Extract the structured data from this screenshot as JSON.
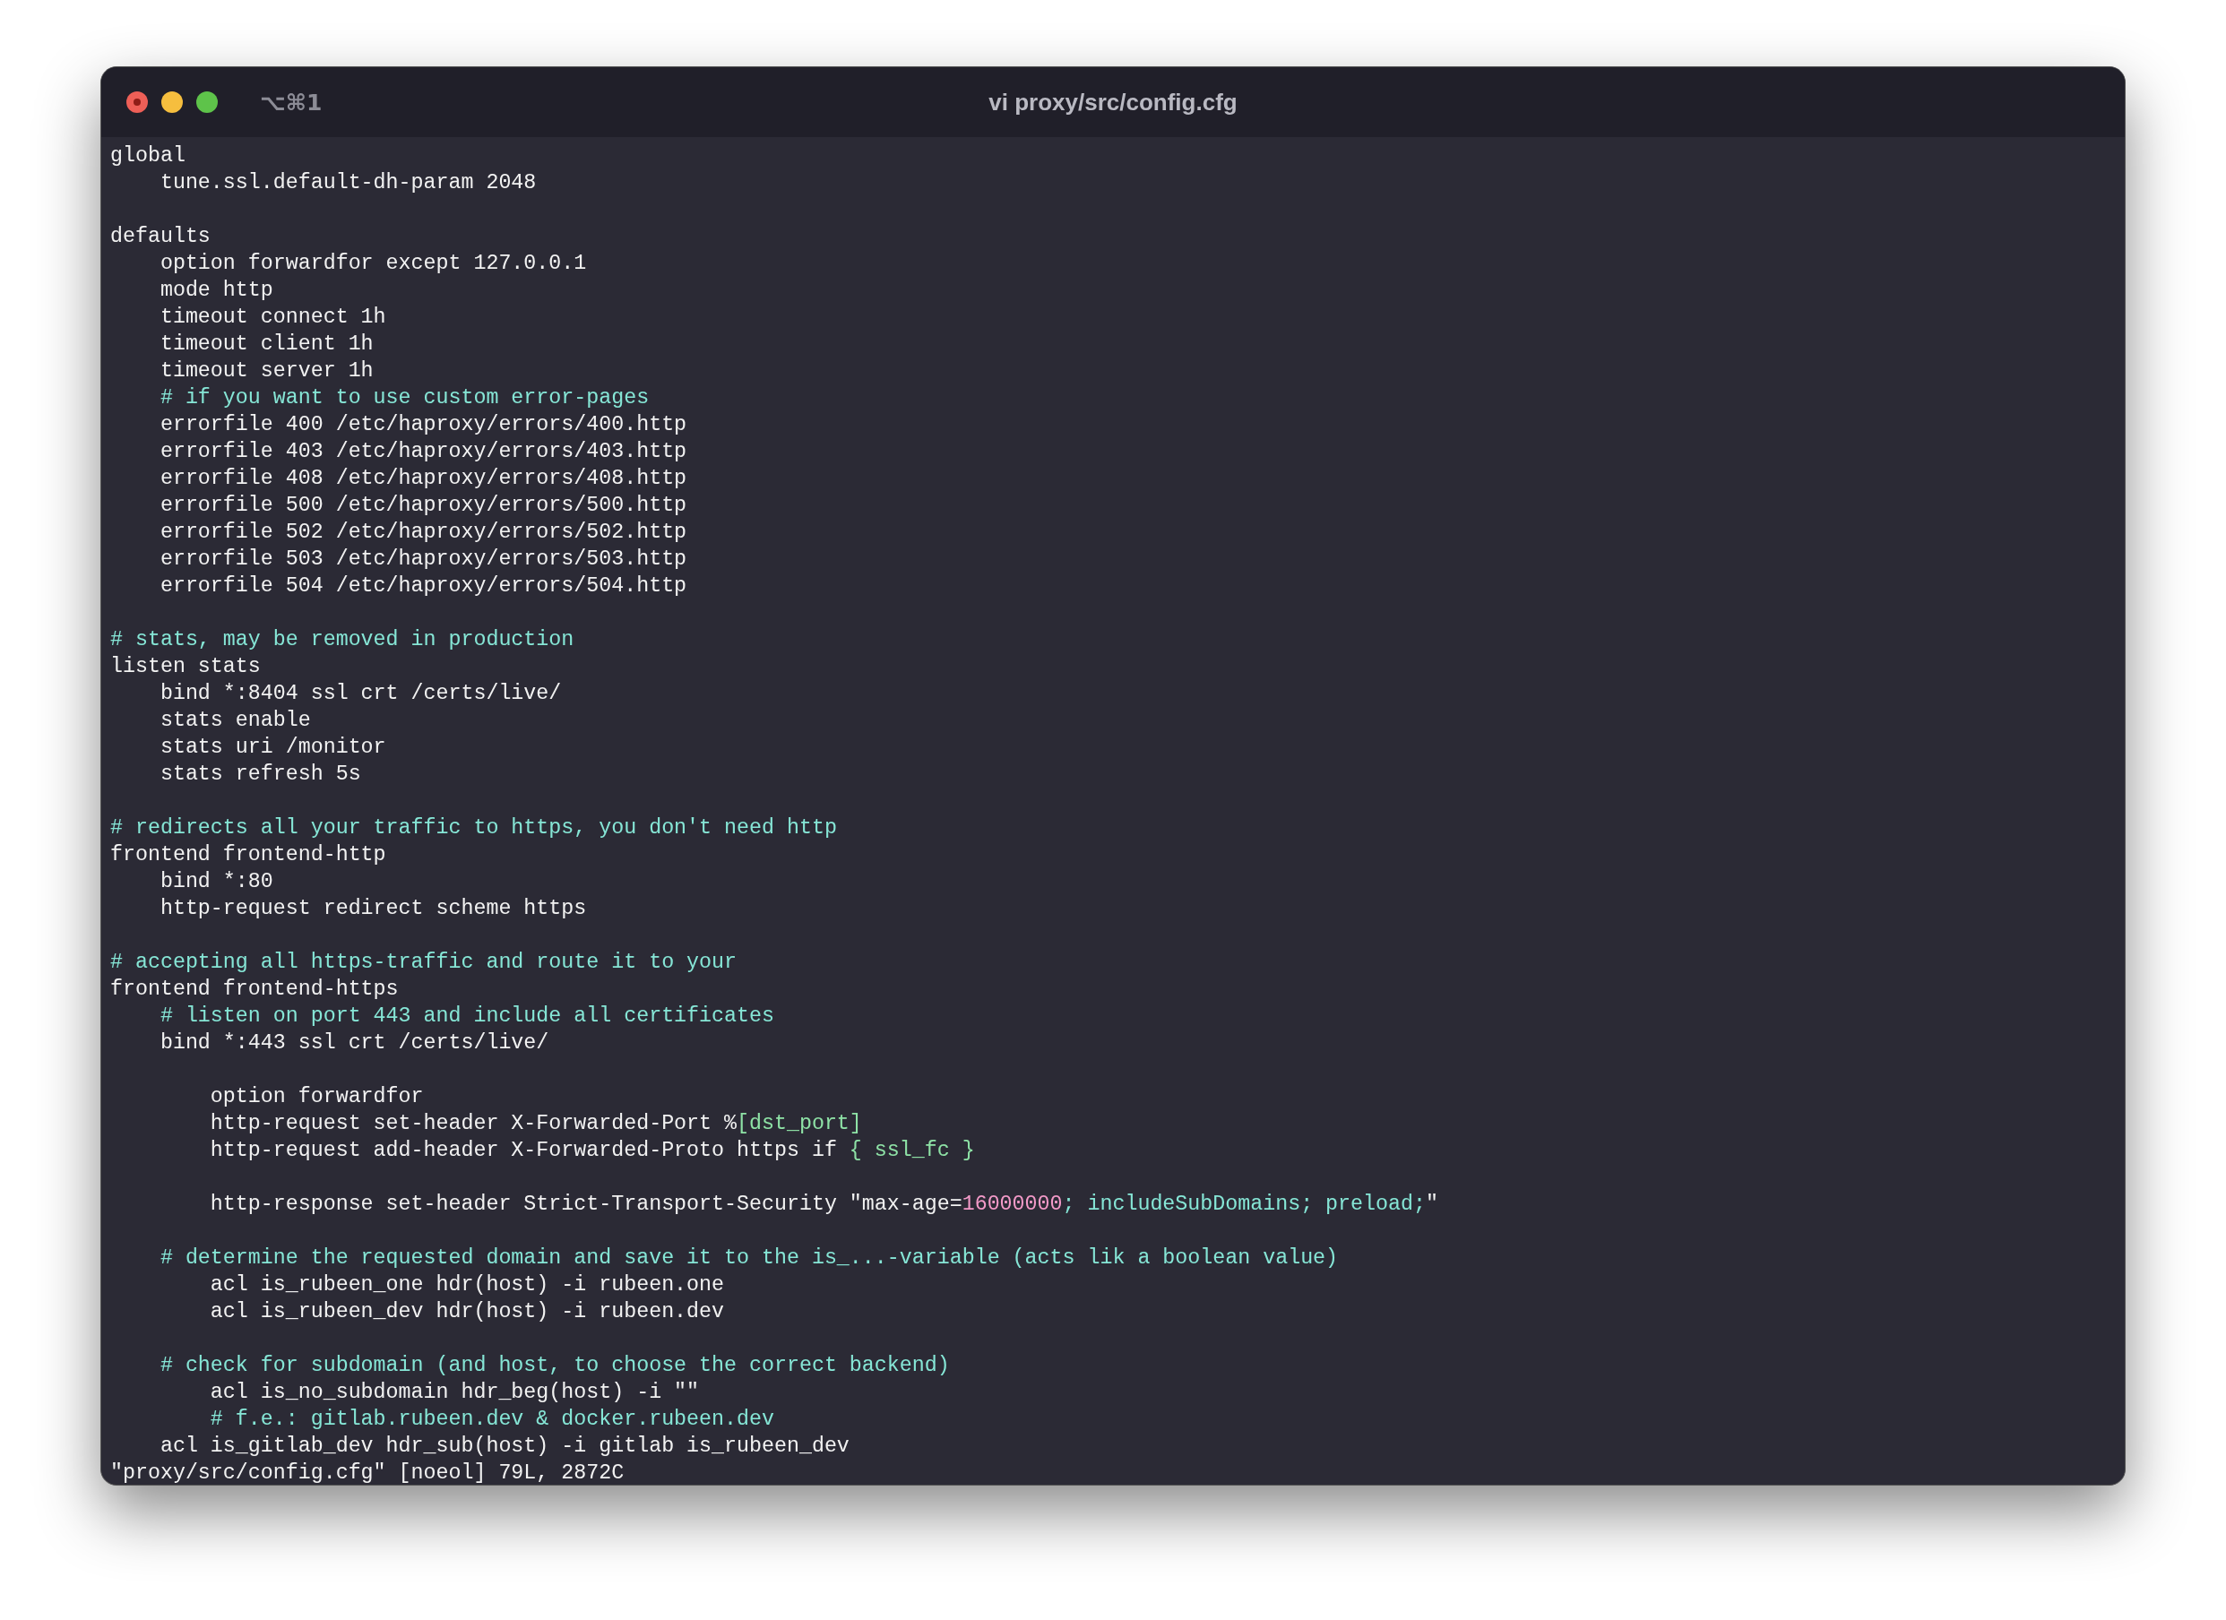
{
  "window": {
    "shortcut": "⌥⌘1",
    "title": "vi proxy/src/config.cfg"
  },
  "editor": {
    "lines": [
      {
        "kind": "code",
        "segments": [
          {
            "kind": "plain",
            "text": "global"
          }
        ]
      },
      {
        "kind": "code",
        "segments": [
          {
            "kind": "plain",
            "text": "    tune.ssl.default-dh-param 2048"
          }
        ]
      },
      {
        "kind": "blank"
      },
      {
        "kind": "code",
        "segments": [
          {
            "kind": "plain",
            "text": "defaults"
          }
        ]
      },
      {
        "kind": "code",
        "segments": [
          {
            "kind": "plain",
            "text": "    option forwardfor except 127.0.0.1"
          }
        ]
      },
      {
        "kind": "code",
        "segments": [
          {
            "kind": "plain",
            "text": "    mode http"
          }
        ]
      },
      {
        "kind": "code",
        "segments": [
          {
            "kind": "plain",
            "text": "    timeout connect 1h"
          }
        ]
      },
      {
        "kind": "code",
        "segments": [
          {
            "kind": "plain",
            "text": "    timeout client 1h"
          }
        ]
      },
      {
        "kind": "code",
        "segments": [
          {
            "kind": "plain",
            "text": "    timeout server 1h"
          }
        ]
      },
      {
        "kind": "code",
        "segments": [
          {
            "kind": "comment",
            "text": "    # if you want to use custom error-pages"
          }
        ]
      },
      {
        "kind": "code",
        "segments": [
          {
            "kind": "plain",
            "text": "    errorfile 400 /etc/haproxy/errors/400.http"
          }
        ]
      },
      {
        "kind": "code",
        "segments": [
          {
            "kind": "plain",
            "text": "    errorfile 403 /etc/haproxy/errors/403.http"
          }
        ]
      },
      {
        "kind": "code",
        "segments": [
          {
            "kind": "plain",
            "text": "    errorfile 408 /etc/haproxy/errors/408.http"
          }
        ]
      },
      {
        "kind": "code",
        "segments": [
          {
            "kind": "plain",
            "text": "    errorfile 500 /etc/haproxy/errors/500.http"
          }
        ]
      },
      {
        "kind": "code",
        "segments": [
          {
            "kind": "plain",
            "text": "    errorfile 502 /etc/haproxy/errors/502.http"
          }
        ]
      },
      {
        "kind": "code",
        "segments": [
          {
            "kind": "plain",
            "text": "    errorfile 503 /etc/haproxy/errors/503.http"
          }
        ]
      },
      {
        "kind": "code",
        "segments": [
          {
            "kind": "plain",
            "text": "    errorfile 504 /etc/haproxy/errors/504.http"
          }
        ]
      },
      {
        "kind": "blank"
      },
      {
        "kind": "code",
        "segments": [
          {
            "kind": "comment",
            "text": "# stats, may be removed in production"
          }
        ]
      },
      {
        "kind": "code",
        "segments": [
          {
            "kind": "plain",
            "text": "listen stats"
          }
        ]
      },
      {
        "kind": "code",
        "segments": [
          {
            "kind": "plain",
            "text": "    bind *:8404 ssl crt /certs/live/"
          }
        ]
      },
      {
        "kind": "code",
        "segments": [
          {
            "kind": "plain",
            "text": "    stats enable"
          }
        ]
      },
      {
        "kind": "code",
        "segments": [
          {
            "kind": "plain",
            "text": "    stats uri /monitor"
          }
        ]
      },
      {
        "kind": "code",
        "segments": [
          {
            "kind": "plain",
            "text": "    stats refresh 5s"
          }
        ]
      },
      {
        "kind": "blank"
      },
      {
        "kind": "code",
        "segments": [
          {
            "kind": "comment",
            "text": "# redirects all your traffic to https, you don't need http"
          }
        ]
      },
      {
        "kind": "code",
        "segments": [
          {
            "kind": "plain",
            "text": "frontend frontend-http"
          }
        ]
      },
      {
        "kind": "code",
        "segments": [
          {
            "kind": "plain",
            "text": "    bind *:80"
          }
        ]
      },
      {
        "kind": "code",
        "segments": [
          {
            "kind": "plain",
            "text": "    http-request redirect scheme https"
          }
        ]
      },
      {
        "kind": "blank"
      },
      {
        "kind": "code",
        "segments": [
          {
            "kind": "comment",
            "text": "# accepting all https-traffic and route it to your"
          }
        ]
      },
      {
        "kind": "code",
        "segments": [
          {
            "kind": "plain",
            "text": "frontend frontend-https"
          }
        ]
      },
      {
        "kind": "code",
        "segments": [
          {
            "kind": "comment",
            "text": "    # listen on port 443 and include all certificates"
          }
        ]
      },
      {
        "kind": "code",
        "segments": [
          {
            "kind": "plain",
            "text": "    bind *:443 ssl crt /certs/live/"
          }
        ]
      },
      {
        "kind": "blank"
      },
      {
        "kind": "code",
        "segments": [
          {
            "kind": "plain",
            "text": "        option forwardfor"
          }
        ]
      },
      {
        "kind": "code",
        "segments": [
          {
            "kind": "plain",
            "text": "        http-request set-header X-Forwarded-Port %"
          },
          {
            "kind": "variable",
            "text": "[dst_port]"
          }
        ]
      },
      {
        "kind": "code",
        "segments": [
          {
            "kind": "plain",
            "text": "        http-request add-header X-Forwarded-Proto https if "
          },
          {
            "kind": "variable",
            "text": "{ ssl_fc }"
          }
        ]
      },
      {
        "kind": "blank"
      },
      {
        "kind": "code",
        "segments": [
          {
            "kind": "plain",
            "text": "        http-response set-header Strict-Transport-Security \"max-age="
          },
          {
            "kind": "number",
            "text": "16000000"
          },
          {
            "kind": "comment",
            "text": "; includeSubDomains; preload;"
          },
          {
            "kind": "plain",
            "text": "\""
          }
        ]
      },
      {
        "kind": "blank"
      },
      {
        "kind": "code",
        "segments": [
          {
            "kind": "comment",
            "text": "    # determine the requested domain and save it to the is_...-variable (acts lik a boolean value)"
          }
        ]
      },
      {
        "kind": "code",
        "segments": [
          {
            "kind": "plain",
            "text": "        acl is_rubeen_one hdr(host) -i rubeen.one"
          }
        ]
      },
      {
        "kind": "code",
        "segments": [
          {
            "kind": "plain",
            "text": "        acl is_rubeen_dev hdr(host) -i rubeen.dev"
          }
        ]
      },
      {
        "kind": "blank"
      },
      {
        "kind": "code",
        "segments": [
          {
            "kind": "comment",
            "text": "    # check for subdomain (and host, to choose the correct backend)"
          }
        ]
      },
      {
        "kind": "code",
        "segments": [
          {
            "kind": "plain",
            "text": "        acl is_no_subdomain hdr_beg(host) -i \"\""
          }
        ]
      },
      {
        "kind": "code",
        "segments": [
          {
            "kind": "comment",
            "text": "        # f.e.: gitlab.rubeen.dev & docker.rubeen.dev"
          }
        ]
      },
      {
        "kind": "code",
        "segments": [
          {
            "kind": "plain",
            "text": "    acl is_gitlab_dev hdr_sub(host) -i gitlab is_rubeen_dev"
          }
        ]
      }
    ]
  },
  "status_bar": {
    "text": "\"proxy/src/config.cfg\" [noeol] 79L, 2872C"
  }
}
